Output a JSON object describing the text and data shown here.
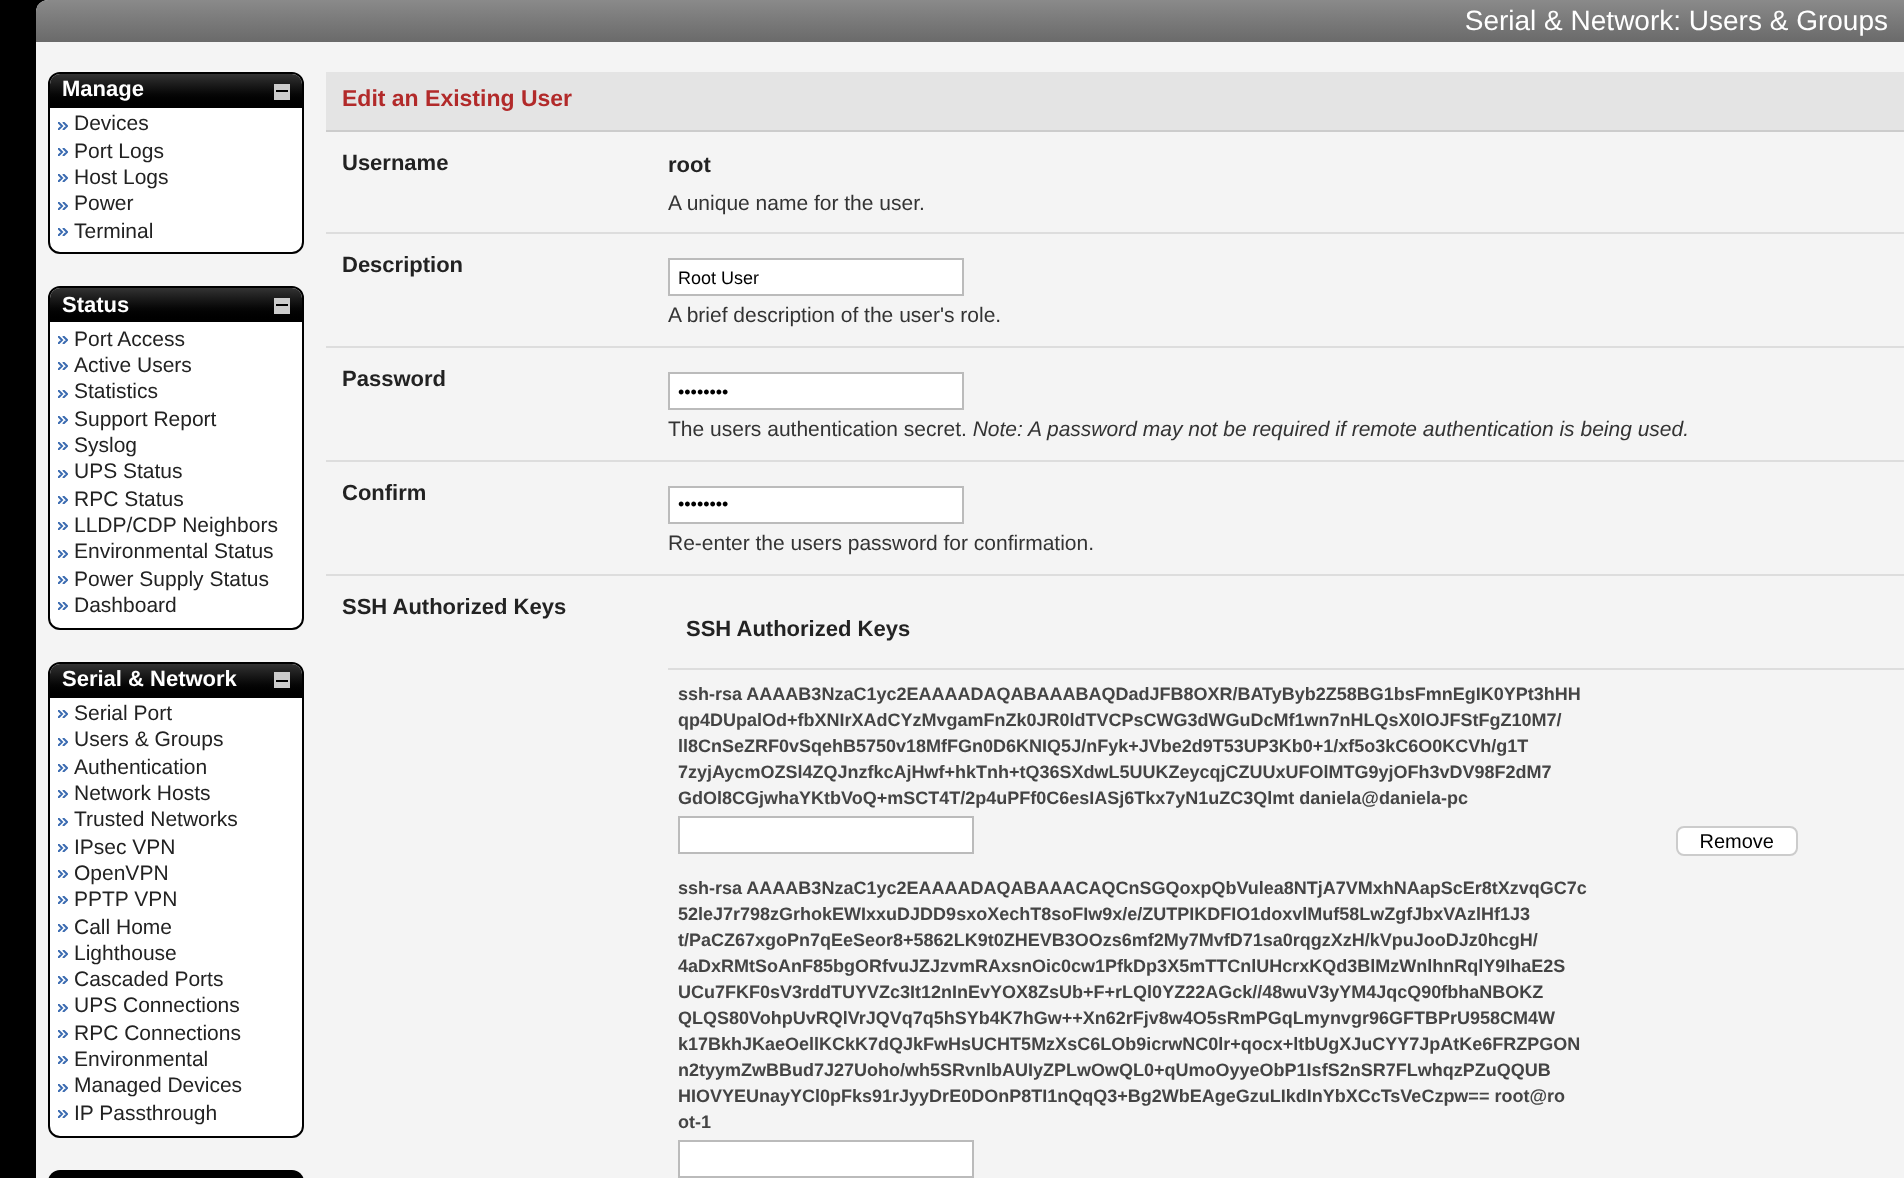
{
  "header": {
    "title": "Serial & Network: Users & Groups"
  },
  "sidebar": {
    "sections": [
      {
        "title": "Manage",
        "items": [
          "Devices",
          "Port Logs",
          "Host Logs",
          "Power",
          "Terminal"
        ]
      },
      {
        "title": "Status",
        "items": [
          "Port Access",
          "Active Users",
          "Statistics",
          "Support Report",
          "Syslog",
          "UPS Status",
          "RPC Status",
          "LLDP/CDP Neighbors",
          "Environmental Status",
          "Power Supply Status",
          "Dashboard"
        ]
      },
      {
        "title": "Serial & Network",
        "items": [
          "Serial Port",
          "Users & Groups",
          "Authentication",
          "Network Hosts",
          "Trusted Networks",
          "IPsec VPN",
          "OpenVPN",
          "PPTP VPN",
          "Call Home",
          "Lighthouse",
          "Cascaded Ports",
          "UPS Connections",
          "RPC Connections",
          "Environmental",
          "Managed Devices",
          "IP Passthrough"
        ]
      }
    ]
  },
  "form": {
    "title": "Edit an Existing User",
    "rows": [
      {
        "kind": "static",
        "label": "Username",
        "value": "root",
        "help": "A unique name for the user."
      },
      {
        "kind": "input",
        "label": "Description",
        "value": "Root User",
        "help": "A brief description of the user's role."
      },
      {
        "kind": "input",
        "label": "Password",
        "value": "••••••••",
        "help": "The users authentication secret. *Note: A password may not be required if remote authentication is being used.*"
      },
      {
        "kind": "input",
        "label": "Confirm",
        "value": "••••••••",
        "help": "Re-enter the users password for confirmation."
      }
    ],
    "ssh": {
      "label": "SSH Authorized Keys",
      "heading": "SSH Authorized Keys",
      "keys": [
        {
          "lines": [
            "ssh-rsa AAAAB3NzaC1yc2EAAAADAQABAAABAQDadJFB8OXR/BATyByb2Z58BG1bsFmnEgIK0YPt3hHH",
            "qp4DUpalOd+fbXNIrXAdCYzMvgamFnZk0JR0ldTVCPsCWG3dWGuDcMf1wn7nHLQsX0lOJFStFgZ10M7/",
            "ll8CnSeZRF0vSqehB5750v18MfFGn0D6KNIQ5J/nFyk+JVbe2d9T53UP3Kb0+1/xf5o3kC6O0KCVh/g1T",
            "7zyjAycmOZSl4ZQJnzfkcAjHwf+hkTnh+tQ36SXdwL5UUKZeycqjCZUUxUFOlMTG9yjOFh3vDV98F2dM7",
            "GdOl8CGjwhaYKtbVoQ+mSCT4T/2p4uPFf0C6esIASj6Tkx7yN1uZC3Qlmt daniela@daniela-pc"
          ],
          "button": "Remove"
        },
        {
          "lines": [
            "ssh-rsa AAAAB3NzaC1yc2EAAAADAQABAAACAQCnSGQoxpQbVulea8NTjA7VMxhNAapScEr8tXzvqGC7c",
            "52leJ7r798zGrhokEWIxxuDJDD9sxoXechT8soFIw9x/e/ZUTPIKDFIO1doxvlMuf58LwZgfJbxVAzlHf1J3",
            "t/PaCZ67xgoPn7qEeSeor8+5862LK9t0ZHEVB3OOzs6mf2My7MvfD71sa0rqgzXzH/kVpuJooDJz0hcgH/",
            "4aDxRMtSoAnF85bgORfvuJZJzvmRAxsnOic0cw1PfkDp3X5mTTCnlUHcrxKQd3BlMzWnlhnRqlY9IhaE2S",
            "UCu7FKF0sV3rddTUYVZc3It12nInEvYOX8ZsUb+F+rLQl0YZ22AGck//48wuV3yYM4JqcQ90fbhaNBOKZ",
            "QLQS80VohpUvRQlVrJQVq7q5hSYb4K7hGw++Xn62rFjv8w4O5sRmPGqLmynvgr96GFTBPrU958CM4W",
            "k17BkhJKaeOellKCkK7dQJkFwHsUCHT5MzXsC6LOb9icrwNC0lr+qocx+ltbUgXJuCYY7JpAtKe6FRZPGON",
            "n2tyymZwBBud7J27Uoho/wh5SRvnlbAUIyZPLwOwQL0+qUmoOyyeObP1IsfS2nSR7FLwhqzPZuQQUB",
            "HIOVYEUnayYCl0pFks91rJyyDrE0DOnP8TI1nQqQ3+Bg2WbEAgeGzuLIkdInYbXCcTsVeCzpw== root@ro",
            "ot-1"
          ]
        }
      ]
    }
  }
}
